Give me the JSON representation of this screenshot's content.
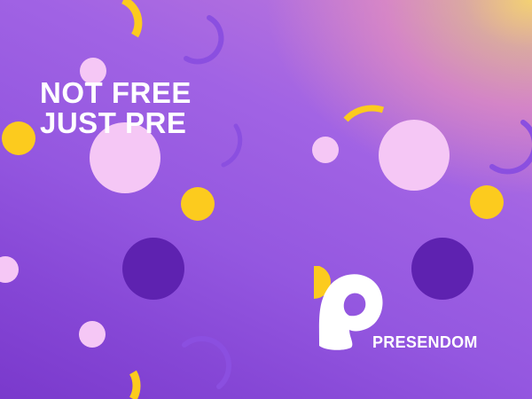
{
  "headline": {
    "line1": "NOT FREE",
    "line2": "JUST PRE"
  },
  "brand": {
    "name": "PRESENDOM",
    "logo_icon": "presendom-p-logo-icon"
  },
  "colors": {
    "yellow": "#fccb1e",
    "light_pink": "#f5c7f5",
    "dark_purple": "#5e22b0",
    "ring_purple": "#8b4fe0",
    "white": "#ffffff"
  }
}
